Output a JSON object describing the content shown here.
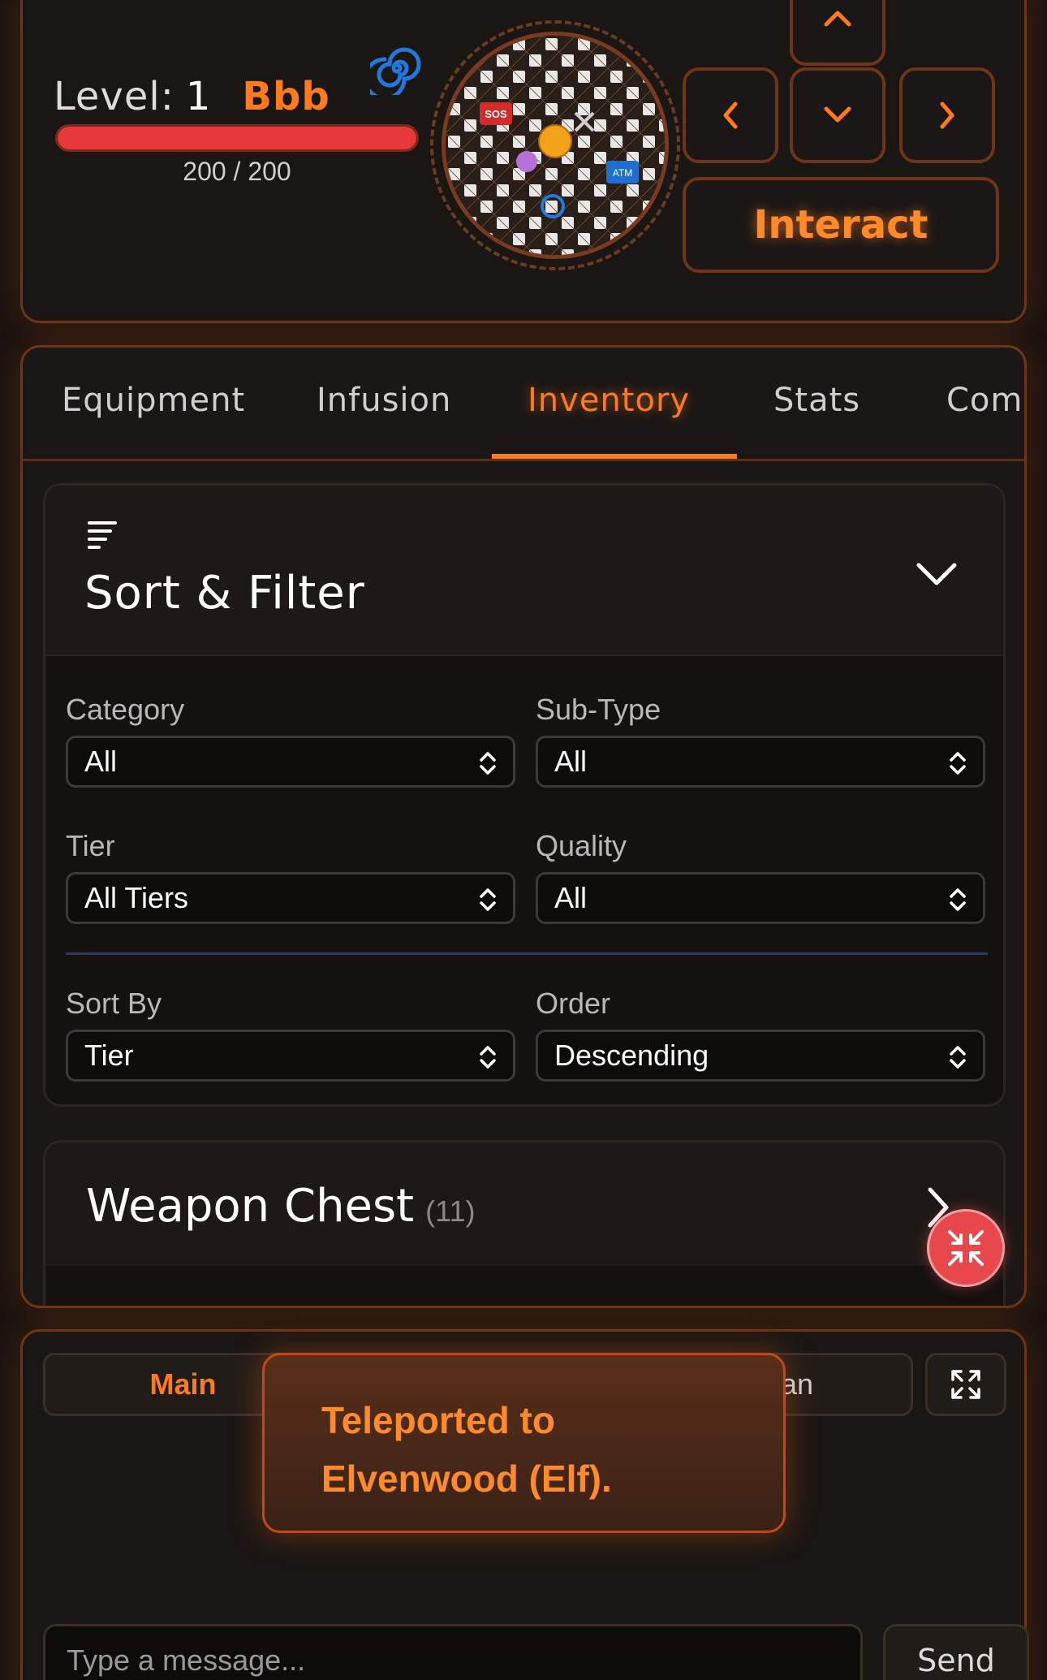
{
  "hud": {
    "level_label": "Level:",
    "level_value": "1",
    "player_name": "Bbb",
    "hp_text": "200 / 200",
    "hp_fraction": 1.0,
    "portal_icon": "spiral-icon",
    "interact_label": "Interact",
    "minimap": {
      "sos_label": "SOS",
      "atm_label": "ATM"
    }
  },
  "tabs": [
    {
      "label": "Equipment"
    },
    {
      "label": "Infusion"
    },
    {
      "label": "Inventory"
    },
    {
      "label": "Stats"
    },
    {
      "label": "Com"
    }
  ],
  "sort_filter": {
    "title": "Sort & Filter",
    "category": {
      "label": "Category",
      "value": "All"
    },
    "sub_type": {
      "label": "Sub-Type",
      "value": "All"
    },
    "tier": {
      "label": "Tier",
      "value": "All Tiers"
    },
    "quality": {
      "label": "Quality",
      "value": "All"
    },
    "sort_by": {
      "label": "Sort By",
      "value": "Tier"
    },
    "order": {
      "label": "Order",
      "value": "Descending"
    }
  },
  "weapon_chest": {
    "title": "Weapon Chest",
    "count": "(11)"
  },
  "chat": {
    "tabs": [
      {
        "label": "Main"
      },
      {
        "label": "an"
      }
    ],
    "input_placeholder": "Type a message...",
    "send_label": "Send"
  },
  "toast": {
    "message": "Teleported to Elvenwood (Elf)."
  },
  "colors": {
    "accent": "#ff7a1a",
    "panel_border": "#6e3417",
    "hp_red": "#e8393a",
    "fab_red": "#e8474c"
  }
}
